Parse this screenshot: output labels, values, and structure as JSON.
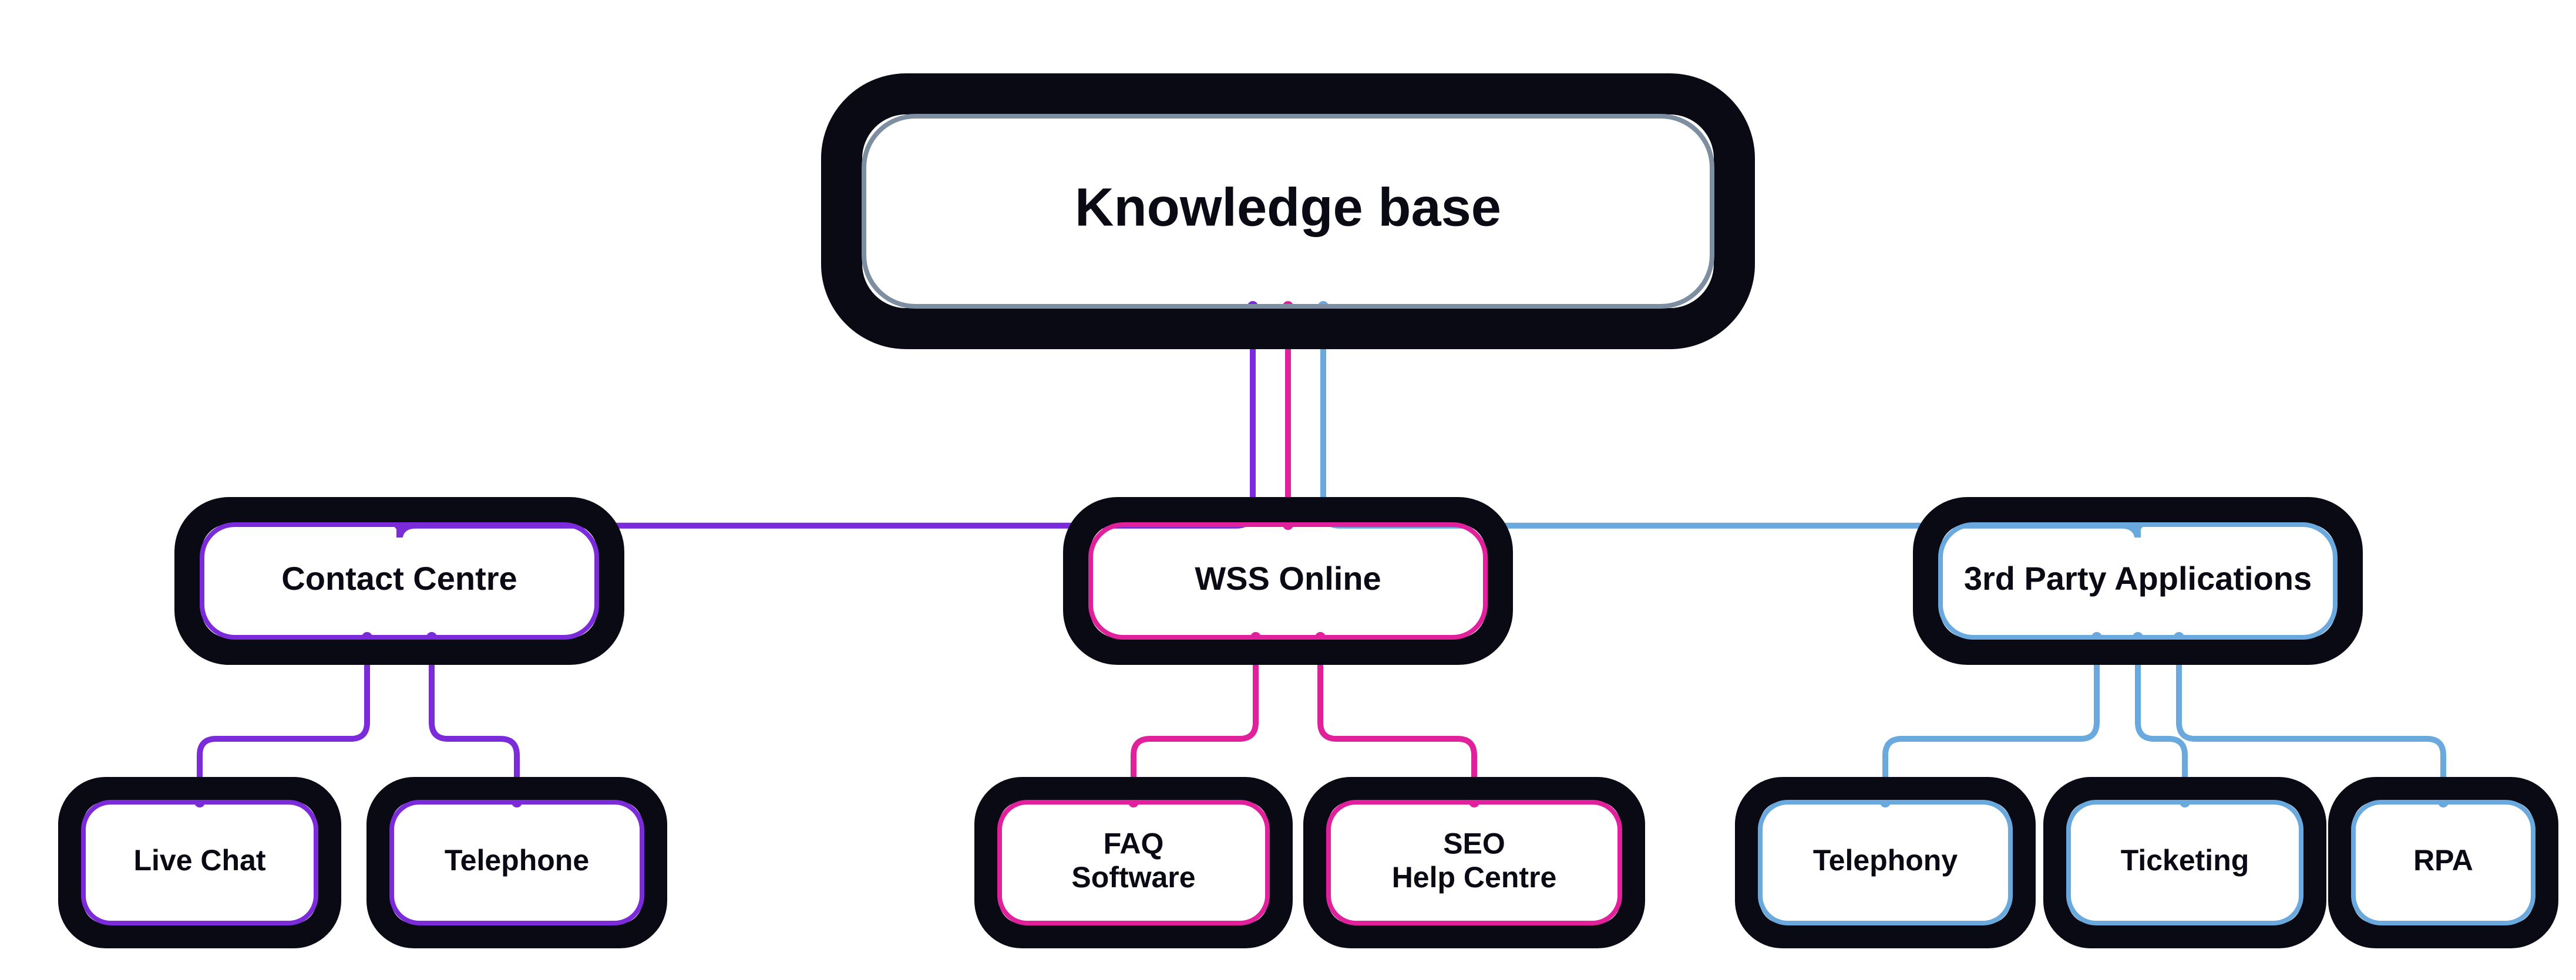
{
  "diagram": {
    "colors": {
      "black": "#0a0a14",
      "grey_inner": "#7d8ea0",
      "purple": "#7b2bd9",
      "magenta": "#e0219b",
      "blue": "#6aa9de",
      "white": "#ffffff"
    },
    "root": {
      "label": "Knowledge base",
      "accent": "grey"
    },
    "branches": [
      {
        "id": "contact-centre",
        "label": "Contact Centre",
        "accent": "purple",
        "children": [
          {
            "id": "live-chat",
            "label": "Live Chat"
          },
          {
            "id": "telephone",
            "label": "Telephone"
          }
        ]
      },
      {
        "id": "wss-online",
        "label": "WSS Online",
        "accent": "magenta",
        "children": [
          {
            "id": "faq-software",
            "label_lines": [
              "FAQ",
              "Software"
            ]
          },
          {
            "id": "seo-help-centre",
            "label_lines": [
              "SEO",
              "Help Centre"
            ]
          }
        ]
      },
      {
        "id": "third-party",
        "label": "3rd Party Applications",
        "accent": "blue",
        "children": [
          {
            "id": "telephony",
            "label": "Telephony"
          },
          {
            "id": "ticketing",
            "label": "Ticketing"
          },
          {
            "id": "rpa",
            "label": "RPA"
          }
        ]
      }
    ]
  }
}
